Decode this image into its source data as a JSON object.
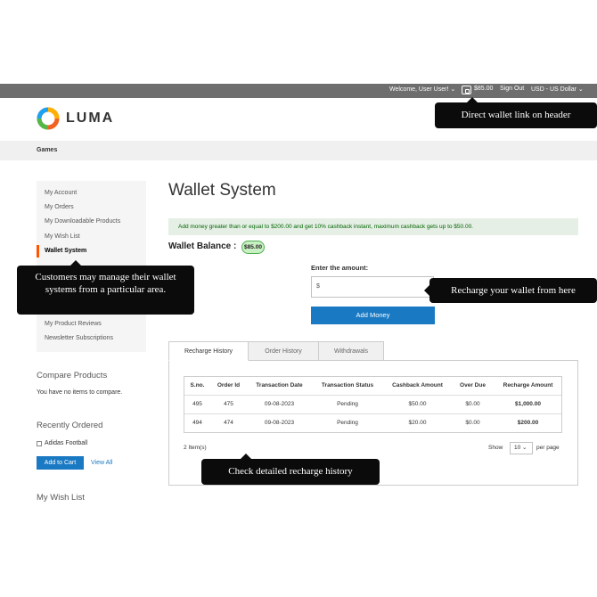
{
  "topbar": {
    "welcome": "Welcome, User User! ⌄",
    "wallet_amount": "$85.00",
    "sign_out": "Sign Out",
    "currency": "USD - US Dollar ⌄"
  },
  "header": {
    "logo_text": "LUMA"
  },
  "nav": {
    "games": "Games"
  },
  "callouts": {
    "header": "Direct wallet link on header",
    "sidebar": "Customers may manage their wallet systems from a particular area.",
    "recharge": "Recharge your wallet from here",
    "history": "Check detailed recharge history"
  },
  "sidebar": {
    "items": [
      "My Account",
      "My Orders",
      "My Downloadable Products",
      "My Wish List",
      "Wallet System",
      "My Product Reviews",
      "Newsletter Subscriptions"
    ]
  },
  "compare": {
    "title": "Compare Products",
    "empty": "You have no items to compare."
  },
  "recent": {
    "title": "Recently Ordered",
    "item": "Adidas Football",
    "add_to_cart": "Add to Cart",
    "view_all": "View All"
  },
  "wishlist": {
    "title": "My Wish List"
  },
  "main": {
    "title": "Wallet System",
    "notice": "Add money greater than or equal to $200.00 and get 10% cashback instant, maximum cashback gets up to $50.00.",
    "balance_label": "Wallet Balance :",
    "balance_value": "$85.00",
    "amount_label": "Enter the amount:",
    "amount_prefix": "$",
    "add_money": "Add Money"
  },
  "tabs": [
    "Recharge History",
    "Order History",
    "Withdrawals"
  ],
  "table": {
    "headers": [
      "S.no.",
      "Order Id",
      "Transaction Date",
      "Transaction Status",
      "Cashback Amount",
      "Over Due",
      "Recharge Amount"
    ],
    "rows": [
      [
        "495",
        "475",
        "09-08-2023",
        "Pending",
        "$50.00",
        "$0.00",
        "$1,000.00"
      ],
      [
        "494",
        "474",
        "09-08-2023",
        "Pending",
        "$20.00",
        "$0.00",
        "$200.00"
      ]
    ]
  },
  "pager": {
    "count": "2 Item(s)",
    "show": "Show",
    "limit": "10 ⌄",
    "per_page": "per page"
  },
  "colors": {
    "accent_blue": "#1979c3",
    "active_orange": "#ff5501",
    "topbar": "#6e6e6e"
  }
}
